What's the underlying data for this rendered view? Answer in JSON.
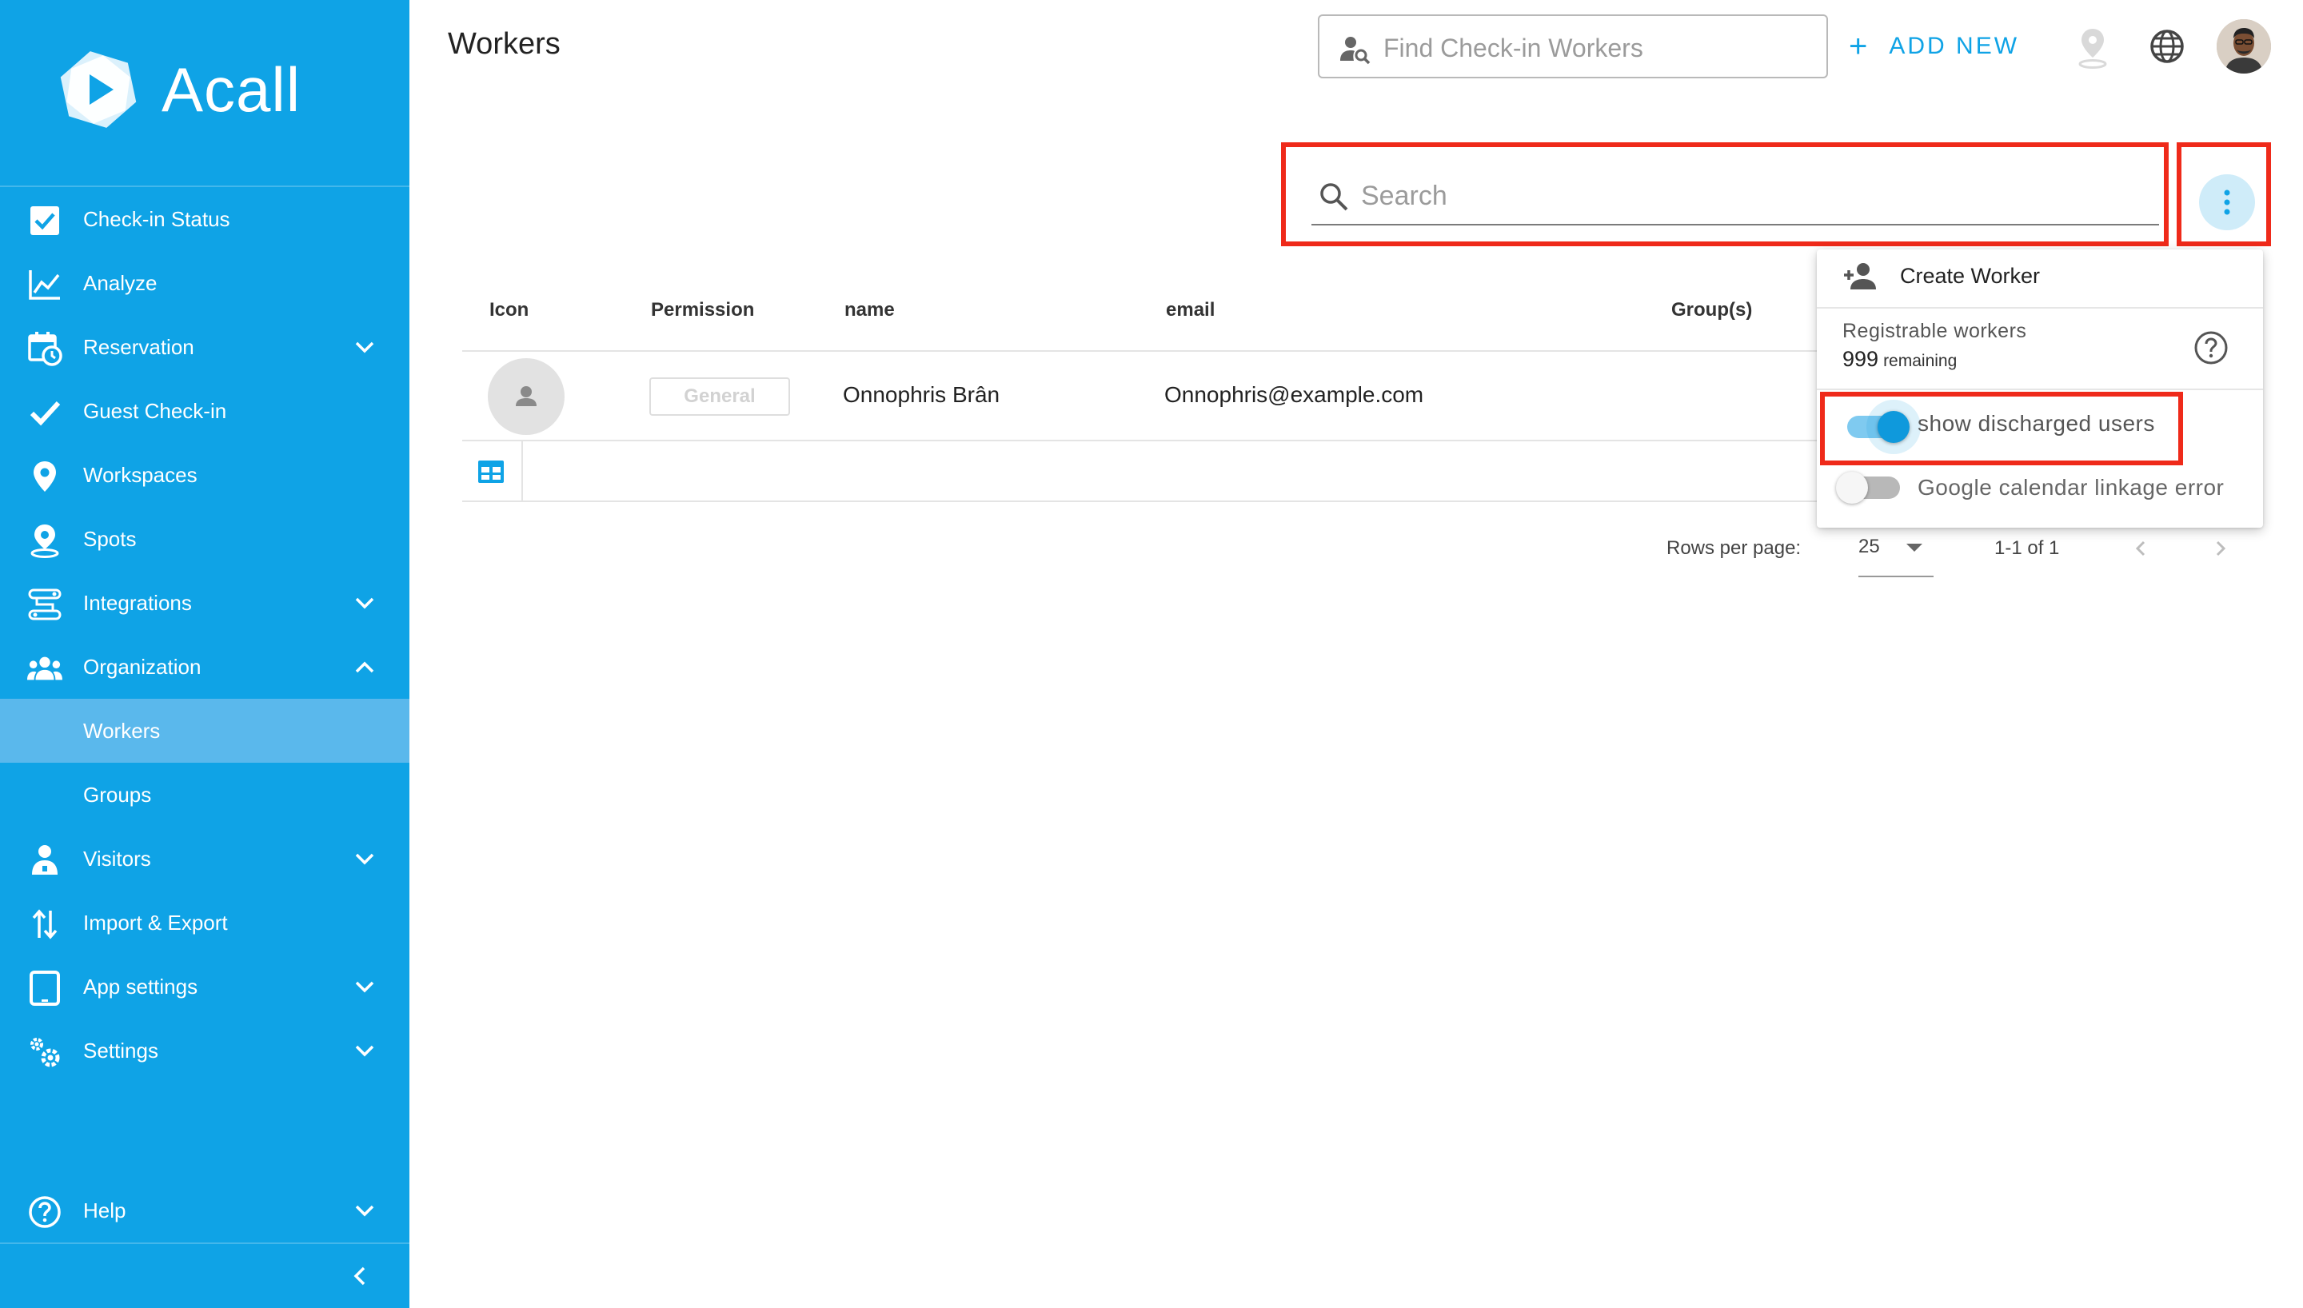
{
  "colors": {
    "sidebar": "#0fa3e6",
    "accent": "#0fa3e6",
    "highlight": "#ef2a1a",
    "active_item": "#5ab8ec"
  },
  "app": {
    "logo_text": "Acall"
  },
  "sidebar": {
    "items": [
      {
        "label": "Check-in Status",
        "icon": "checkbox-icon"
      },
      {
        "label": "Analyze",
        "icon": "line-chart-icon"
      },
      {
        "label": "Reservation",
        "icon": "calendar-clock-icon",
        "expandable": true
      },
      {
        "label": "Guest Check-in",
        "icon": "checkmark-icon"
      },
      {
        "label": "Workspaces",
        "icon": "map-pin-icon"
      },
      {
        "label": "Spots",
        "icon": "spot-pin-icon"
      },
      {
        "label": "Integrations",
        "icon": "integrations-icon",
        "expandable": true
      },
      {
        "label": "Organization",
        "icon": "people-icon",
        "expanded": true
      },
      {
        "label": "Workers",
        "active": true
      },
      {
        "label": "Groups"
      },
      {
        "label": "Visitors",
        "icon": "visitor-icon",
        "expandable": true
      },
      {
        "label": "Import & Export",
        "icon": "import-export-icon"
      },
      {
        "label": "App settings",
        "icon": "tablet-icon",
        "expandable": true
      },
      {
        "label": "Settings",
        "icon": "gears-icon",
        "expandable": true
      },
      {
        "label": "Help",
        "icon": "help-circle-icon",
        "expandable": true
      }
    ]
  },
  "header": {
    "title": "Workers",
    "find_placeholder": "Find Check-in Workers",
    "add_new": "ADD NEW"
  },
  "search": {
    "placeholder": "Search"
  },
  "table": {
    "columns": [
      "Icon",
      "Permission",
      "name",
      "email",
      "Group(s)"
    ],
    "rows": [
      {
        "permission": "General",
        "name": "Onnophris Brân",
        "email": "Onnophris@example.com"
      }
    ]
  },
  "pagination": {
    "rows_per_page_label": "Rows per page:",
    "rows_per_page": "25",
    "range": "1-1 of 1"
  },
  "menu": {
    "create_worker": "Create Worker",
    "registrable_label": "Registrable workers",
    "registrable_count": "999",
    "registrable_remaining": "remaining",
    "show_discharged": {
      "label": "show discharged users",
      "on": true
    },
    "google_error": {
      "label": "Google calendar linkage error",
      "on": false
    }
  }
}
